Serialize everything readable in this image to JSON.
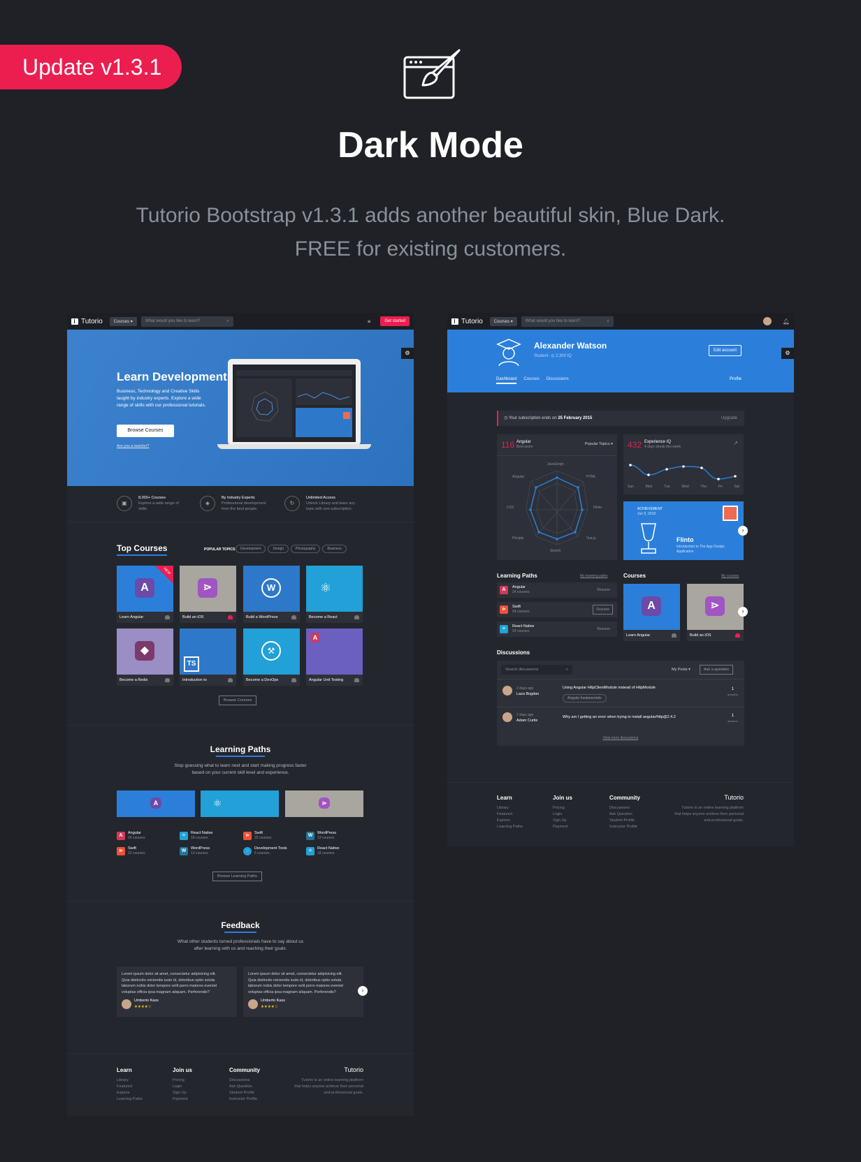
{
  "ribbon": "Update v1.3.1",
  "title": "Dark Mode",
  "subtitle_line1": "Tutorio Bootstrap v1.3.1 adds another beautiful skin, Blue Dark.",
  "subtitle_line2": "FREE for existing customers.",
  "left": {
    "nav": {
      "logo": "Tutorio",
      "courses": "Courses ▾",
      "search_placeholder": "What would you like to learn?",
      "cta": "Get started"
    },
    "hero": {
      "title": "Learn Development",
      "text1": "Business, Technology and Creative Skills",
      "text2": "taught by industry experts. Explore a wide",
      "text3": "range of skills with our professional tutorials.",
      "button": "Browse Courses",
      "link": "Are you a teacher?"
    },
    "features": [
      {
        "title": "8,000+ Courses",
        "l1": "Explore a wide range of",
        "l2": "skills."
      },
      {
        "title": "By Industry Experts",
        "l1": "Professional development",
        "l2": "from the best people."
      },
      {
        "title": "Unlimited Access",
        "l1": "Unlock Library and learn any",
        "l2": "topic with one subscription."
      }
    ],
    "top_courses": "Top Courses",
    "popular_topics": "POPULAR TOPICS",
    "topics": [
      "Development",
      "Design",
      "Photography",
      "Business"
    ],
    "new_tag": "NEW",
    "courses": [
      "Learn Angular",
      "Build an iOS",
      "Build a WordPress",
      "Become a React",
      "Become a Redis",
      "Introduction to",
      "Become a DevOps",
      "Angular Unit Testing"
    ],
    "browse_courses": "Browse Courses",
    "paths_title": "Learning Paths",
    "paths_text1": "Stop guessing what to learn next and start making progress faster",
    "paths_text2": "based on your current skill level and experience.",
    "paths": [
      {
        "name": "Angular",
        "count": "24 courses"
      },
      {
        "name": "React Native",
        "count": "18 courses"
      },
      {
        "name": "Swift",
        "count": "22 courses"
      },
      {
        "name": "WordPress",
        "count": "13 courses"
      },
      {
        "name": "Swift",
        "count": "22 courses"
      },
      {
        "name": "WordPress",
        "count": "13 courses"
      },
      {
        "name": "Development Tools",
        "count": "5 courses"
      },
      {
        "name": "React Native",
        "count": "18 courses"
      }
    ],
    "browse_paths": "Browse Learning Paths",
    "feedback_title": "Feedback",
    "feedback_text1": "What other students turned professionals have to say about us",
    "feedback_text2": "after learning with us and reaching their goals.",
    "testimonial_l1": "Lorem ipsum dolor sit amet, consectetur adipisicing elit.",
    "testimonial_l2": "Quia distinctio reiciendis iusto id, doloribus optio soluta",
    "testimonial_l3": "laborum nobis dolor tempore velit porro maiores eveniet",
    "testimonial_l4": "voluptas officia ipsa magnam aliquam. Perferendis?",
    "testimonial_author": "Umberto Kass",
    "stars": "★★★★☆"
  },
  "footer": {
    "learn": "Learn",
    "learn_items": [
      "Library",
      "Featured",
      "Explore",
      "Learning Paths"
    ],
    "join": "Join us",
    "join_items": [
      "Pricing",
      "Login",
      "Sign Up",
      "Payment"
    ],
    "community": "Community",
    "community_items": [
      "Discussions",
      "Ask Question",
      "Student Profile",
      "Instructor Profile"
    ],
    "brand": "Tutorio",
    "about1": "Tutorio is an online learning platform",
    "about2": "that helps anyone achieve their personal",
    "about3": "and professional goals."
  },
  "right": {
    "name": "Alexander Watson",
    "role": "Student",
    "iq": "2,300 IQ",
    "edit": "Edit account",
    "tabs": [
      "Dashboard",
      "Courses",
      "Discussions"
    ],
    "profile": "Profile",
    "subscription_pre": "Your subscription ends on",
    "subscription_date": "25 February 2015",
    "upgrade": "Upgrade",
    "angular_score": "116",
    "angular_title": "Angular",
    "angular_sub": "Best score",
    "popular": "Popular Topics ▾",
    "radar_labels": [
      "JavaScript",
      "HTML",
      "Flinto",
      "Vue.js",
      "Sketch",
      "Priciple",
      "CSS",
      "Angular"
    ],
    "iq_score": "432",
    "iq_title": "Experience IQ",
    "iq_sub": "4 days streak this week",
    "days": [
      "Sun",
      "Mon",
      "Tue",
      "Wed",
      "Thu",
      "Fri",
      "Sat"
    ],
    "achievement": "ACHIEVEMENT",
    "ach_date": "Jun 5, 2018",
    "ach_title": "Flinto",
    "ach_sub1": "Introduction to The App Design",
    "ach_sub2": "Application",
    "lp_title": "Learning Paths",
    "lp_link": "My learning paths",
    "lps": [
      {
        "name": "Angular",
        "count": "24 courses"
      },
      {
        "name": "Swift",
        "count": "24 courses"
      },
      {
        "name": "React Native",
        "count": "24 courses"
      }
    ],
    "resume": "Resume",
    "courses_title": "Courses",
    "courses_link": "My courses",
    "course1": "Learn Angular",
    "course2": "Build an iOS",
    "disc_title": "Discussions",
    "disc_search": "Search discussions",
    "my_posts": "My Posts ▾",
    "ask": "Ask a question",
    "discussions": [
      {
        "time": "2 days ago",
        "user": "Laza Bogdan",
        "q": "Using Angular HttpClientModule instead of HttpModule",
        "tag": "Angular fundamentals",
        "answers": "1",
        "alabel": "answers"
      },
      {
        "time": "2 days ago",
        "user": "Adam Curtis",
        "q": "Why am I getting an error when trying to install angular/http@2.4.2",
        "tag": "",
        "answers": "1",
        "alabel": "answers"
      }
    ],
    "view_more": "View more discussions"
  },
  "colors": {
    "accent": "#ec1e50",
    "blue": "#2b7fdb",
    "bg": "#1f2127",
    "panel": "#2d3038"
  }
}
